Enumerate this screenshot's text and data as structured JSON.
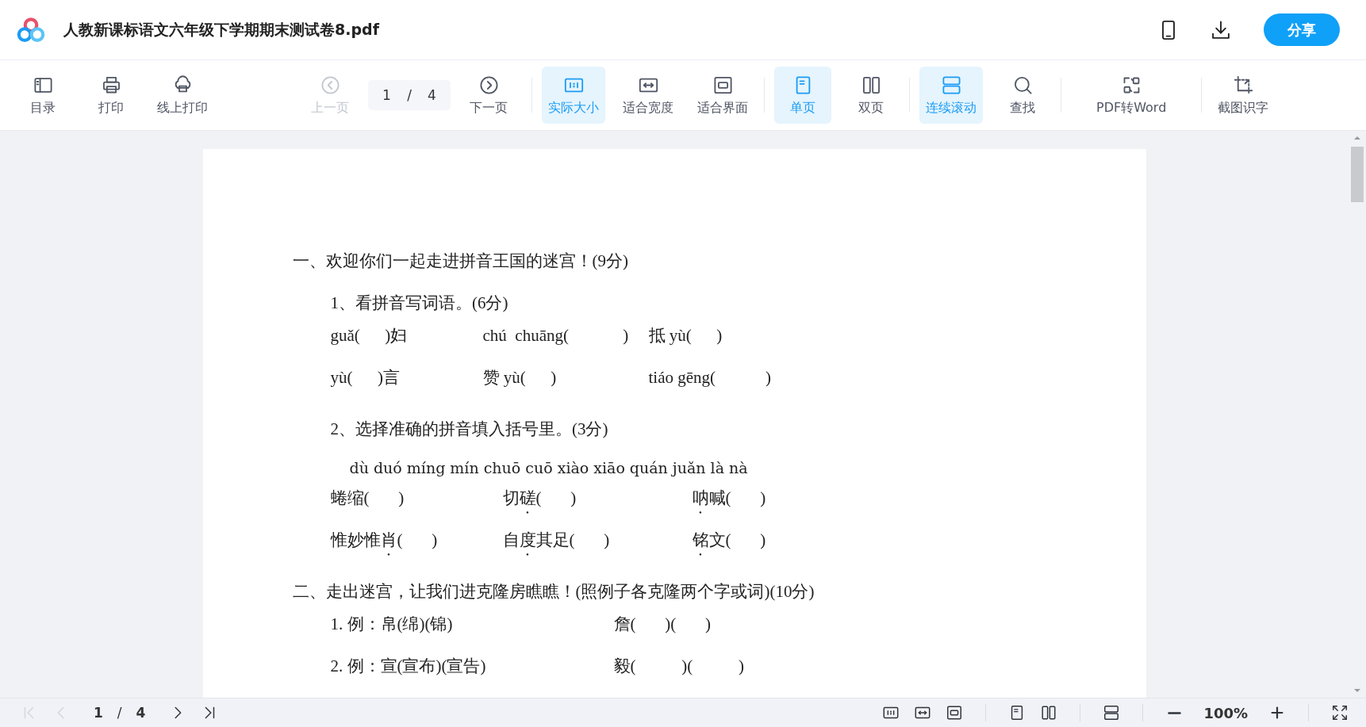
{
  "header": {
    "title": "人教新课标语文六年级下学期期末测试卷8.pdf",
    "share_button": "分享"
  },
  "toolbar": {
    "left": [
      {
        "label": "目录",
        "selected": false
      },
      {
        "label": "打印",
        "selected": false
      },
      {
        "label": "线上打印",
        "selected": false
      }
    ],
    "pager": {
      "prev": {
        "label": "上一页",
        "disabled": true
      },
      "page": "1",
      "separator": "/",
      "total": "4",
      "next": {
        "label": "下一页",
        "disabled": false
      }
    },
    "groups": [
      [
        {
          "label": "实际大小",
          "selected": true
        },
        {
          "label": "适合宽度",
          "selected": false
        },
        {
          "label": "适合界面",
          "selected": false
        }
      ],
      [
        {
          "label": "单页",
          "selected": true
        },
        {
          "label": "双页",
          "selected": false
        }
      ],
      [
        {
          "label": "连续滚动",
          "selected": true
        },
        {
          "label": "查找",
          "selected": false
        }
      ],
      [
        {
          "label": "PDF转Word",
          "selected": false
        }
      ],
      [
        {
          "label": "截图识字",
          "selected": false
        }
      ]
    ]
  },
  "document": {
    "lines": [
      {
        "kind": "heading",
        "text": "一、欢迎你们一起走进拼音王国的迷宫！(9分)"
      },
      {
        "kind": "question",
        "text": "1、看拼音写词语。(6分)"
      },
      {
        "kind": "blanks",
        "items": [
          {
            "text": "guǎ(      )妇"
          },
          {
            "text": "chú  chuāng(             )"
          },
          {
            "text": "抵 yù(      )"
          }
        ]
      },
      {
        "kind": "blanks",
        "items": [
          {
            "text": "yù(      )言"
          },
          {
            "text": "赞 yù(      )"
          },
          {
            "text": "tiáo gēng(            )"
          }
        ]
      },
      {
        "kind": "question",
        "text": "2、选择准确的拼音填入括号里。(3分)"
      },
      {
        "kind": "pinyin",
        "text": "dù duó míng mín chuō cuō xiào xiāo quán juǎn là nà"
      },
      {
        "kind": "choices",
        "items": [
          {
            "before": "蜷缩(       )"
          },
          {
            "before": "切",
            "dotted": "磋",
            "after": "(       )"
          },
          {
            "dotted": "呐",
            "after": "喊(       )"
          }
        ]
      },
      {
        "kind": "choices",
        "items": [
          {
            "before": "惟妙惟",
            "dotted": "肖",
            "after": "(       )"
          },
          {
            "before": "自",
            "dotted": "度",
            "after": "其足(       )"
          },
          {
            "dotted": "铭",
            "after": "文(       )"
          }
        ]
      },
      {
        "kind": "heading",
        "text": "二、走出迷宫，让我们进克隆房瞧瞧！(照例子各克隆两个字或词)(10分)"
      },
      {
        "kind": "examples",
        "items": [
          {
            "text": "1. 例：帛(绵)(锦)"
          },
          {
            "text": "詹(       )(       )"
          }
        ]
      },
      {
        "kind": "examples",
        "items": [
          {
            "text": "2. 例：宣(宣布)(宣告)"
          },
          {
            "text": "毅(           )(           )"
          }
        ]
      }
    ]
  },
  "bottom_bar": {
    "nav_buttons": [
      {
        "disabled": true
      },
      {
        "disabled": true
      },
      {
        "disabled": false
      },
      {
        "disabled": false
      }
    ],
    "page": "1",
    "separator": "/",
    "total": "4",
    "zoom": "100%"
  }
}
